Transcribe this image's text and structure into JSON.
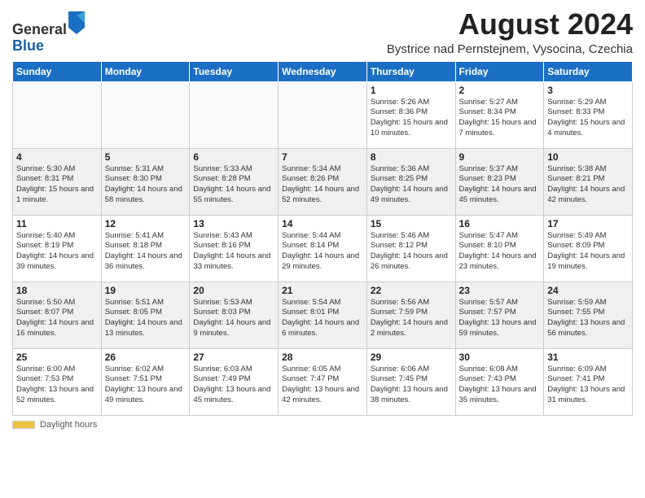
{
  "logo": {
    "general": "General",
    "blue": "Blue"
  },
  "header": {
    "title": "August 2024",
    "subtitle": "Bystrice nad Pernstejnem, Vysocina, Czechia"
  },
  "days": [
    "Sunday",
    "Monday",
    "Tuesday",
    "Wednesday",
    "Thursday",
    "Friday",
    "Saturday"
  ],
  "weeks": [
    [
      {
        "num": "",
        "text": "",
        "empty": true
      },
      {
        "num": "",
        "text": "",
        "empty": true
      },
      {
        "num": "",
        "text": "",
        "empty": true
      },
      {
        "num": "",
        "text": "",
        "empty": true
      },
      {
        "num": "1",
        "text": "Sunrise: 5:26 AM\nSunset: 8:36 PM\nDaylight: 15 hours and 10 minutes."
      },
      {
        "num": "2",
        "text": "Sunrise: 5:27 AM\nSunset: 8:34 PM\nDaylight: 15 hours and 7 minutes."
      },
      {
        "num": "3",
        "text": "Sunrise: 5:29 AM\nSunset: 8:33 PM\nDaylight: 15 hours and 4 minutes."
      }
    ],
    [
      {
        "num": "4",
        "text": "Sunrise: 5:30 AM\nSunset: 8:31 PM\nDaylight: 15 hours and 1 minute."
      },
      {
        "num": "5",
        "text": "Sunrise: 5:31 AM\nSunset: 8:30 PM\nDaylight: 14 hours and 58 minutes."
      },
      {
        "num": "6",
        "text": "Sunrise: 5:33 AM\nSunset: 8:28 PM\nDaylight: 14 hours and 55 minutes."
      },
      {
        "num": "7",
        "text": "Sunrise: 5:34 AM\nSunset: 8:26 PM\nDaylight: 14 hours and 52 minutes."
      },
      {
        "num": "8",
        "text": "Sunrise: 5:36 AM\nSunset: 8:25 PM\nDaylight: 14 hours and 49 minutes."
      },
      {
        "num": "9",
        "text": "Sunrise: 5:37 AM\nSunset: 8:23 PM\nDaylight: 14 hours and 45 minutes."
      },
      {
        "num": "10",
        "text": "Sunrise: 5:38 AM\nSunset: 8:21 PM\nDaylight: 14 hours and 42 minutes."
      }
    ],
    [
      {
        "num": "11",
        "text": "Sunrise: 5:40 AM\nSunset: 8:19 PM\nDaylight: 14 hours and 39 minutes."
      },
      {
        "num": "12",
        "text": "Sunrise: 5:41 AM\nSunset: 8:18 PM\nDaylight: 14 hours and 36 minutes."
      },
      {
        "num": "13",
        "text": "Sunrise: 5:43 AM\nSunset: 8:16 PM\nDaylight: 14 hours and 33 minutes."
      },
      {
        "num": "14",
        "text": "Sunrise: 5:44 AM\nSunset: 8:14 PM\nDaylight: 14 hours and 29 minutes."
      },
      {
        "num": "15",
        "text": "Sunrise: 5:46 AM\nSunset: 8:12 PM\nDaylight: 14 hours and 26 minutes."
      },
      {
        "num": "16",
        "text": "Sunrise: 5:47 AM\nSunset: 8:10 PM\nDaylight: 14 hours and 23 minutes."
      },
      {
        "num": "17",
        "text": "Sunrise: 5:49 AM\nSunset: 8:09 PM\nDaylight: 14 hours and 19 minutes."
      }
    ],
    [
      {
        "num": "18",
        "text": "Sunrise: 5:50 AM\nSunset: 8:07 PM\nDaylight: 14 hours and 16 minutes."
      },
      {
        "num": "19",
        "text": "Sunrise: 5:51 AM\nSunset: 8:05 PM\nDaylight: 14 hours and 13 minutes."
      },
      {
        "num": "20",
        "text": "Sunrise: 5:53 AM\nSunset: 8:03 PM\nDaylight: 14 hours and 9 minutes."
      },
      {
        "num": "21",
        "text": "Sunrise: 5:54 AM\nSunset: 8:01 PM\nDaylight: 14 hours and 6 minutes."
      },
      {
        "num": "22",
        "text": "Sunrise: 5:56 AM\nSunset: 7:59 PM\nDaylight: 14 hours and 2 minutes."
      },
      {
        "num": "23",
        "text": "Sunrise: 5:57 AM\nSunset: 7:57 PM\nDaylight: 13 hours and 59 minutes."
      },
      {
        "num": "24",
        "text": "Sunrise: 5:59 AM\nSunset: 7:55 PM\nDaylight: 13 hours and 56 minutes."
      }
    ],
    [
      {
        "num": "25",
        "text": "Sunrise: 6:00 AM\nSunset: 7:53 PM\nDaylight: 13 hours and 52 minutes."
      },
      {
        "num": "26",
        "text": "Sunrise: 6:02 AM\nSunset: 7:51 PM\nDaylight: 13 hours and 49 minutes."
      },
      {
        "num": "27",
        "text": "Sunrise: 6:03 AM\nSunset: 7:49 PM\nDaylight: 13 hours and 45 minutes."
      },
      {
        "num": "28",
        "text": "Sunrise: 6:05 AM\nSunset: 7:47 PM\nDaylight: 13 hours and 42 minutes."
      },
      {
        "num": "29",
        "text": "Sunrise: 6:06 AM\nSunset: 7:45 PM\nDaylight: 13 hours and 38 minutes."
      },
      {
        "num": "30",
        "text": "Sunrise: 6:08 AM\nSunset: 7:43 PM\nDaylight: 13 hours and 35 minutes."
      },
      {
        "num": "31",
        "text": "Sunrise: 6:09 AM\nSunset: 7:41 PM\nDaylight: 13 hours and 31 minutes."
      }
    ]
  ],
  "footer": {
    "label": "Daylight hours"
  }
}
